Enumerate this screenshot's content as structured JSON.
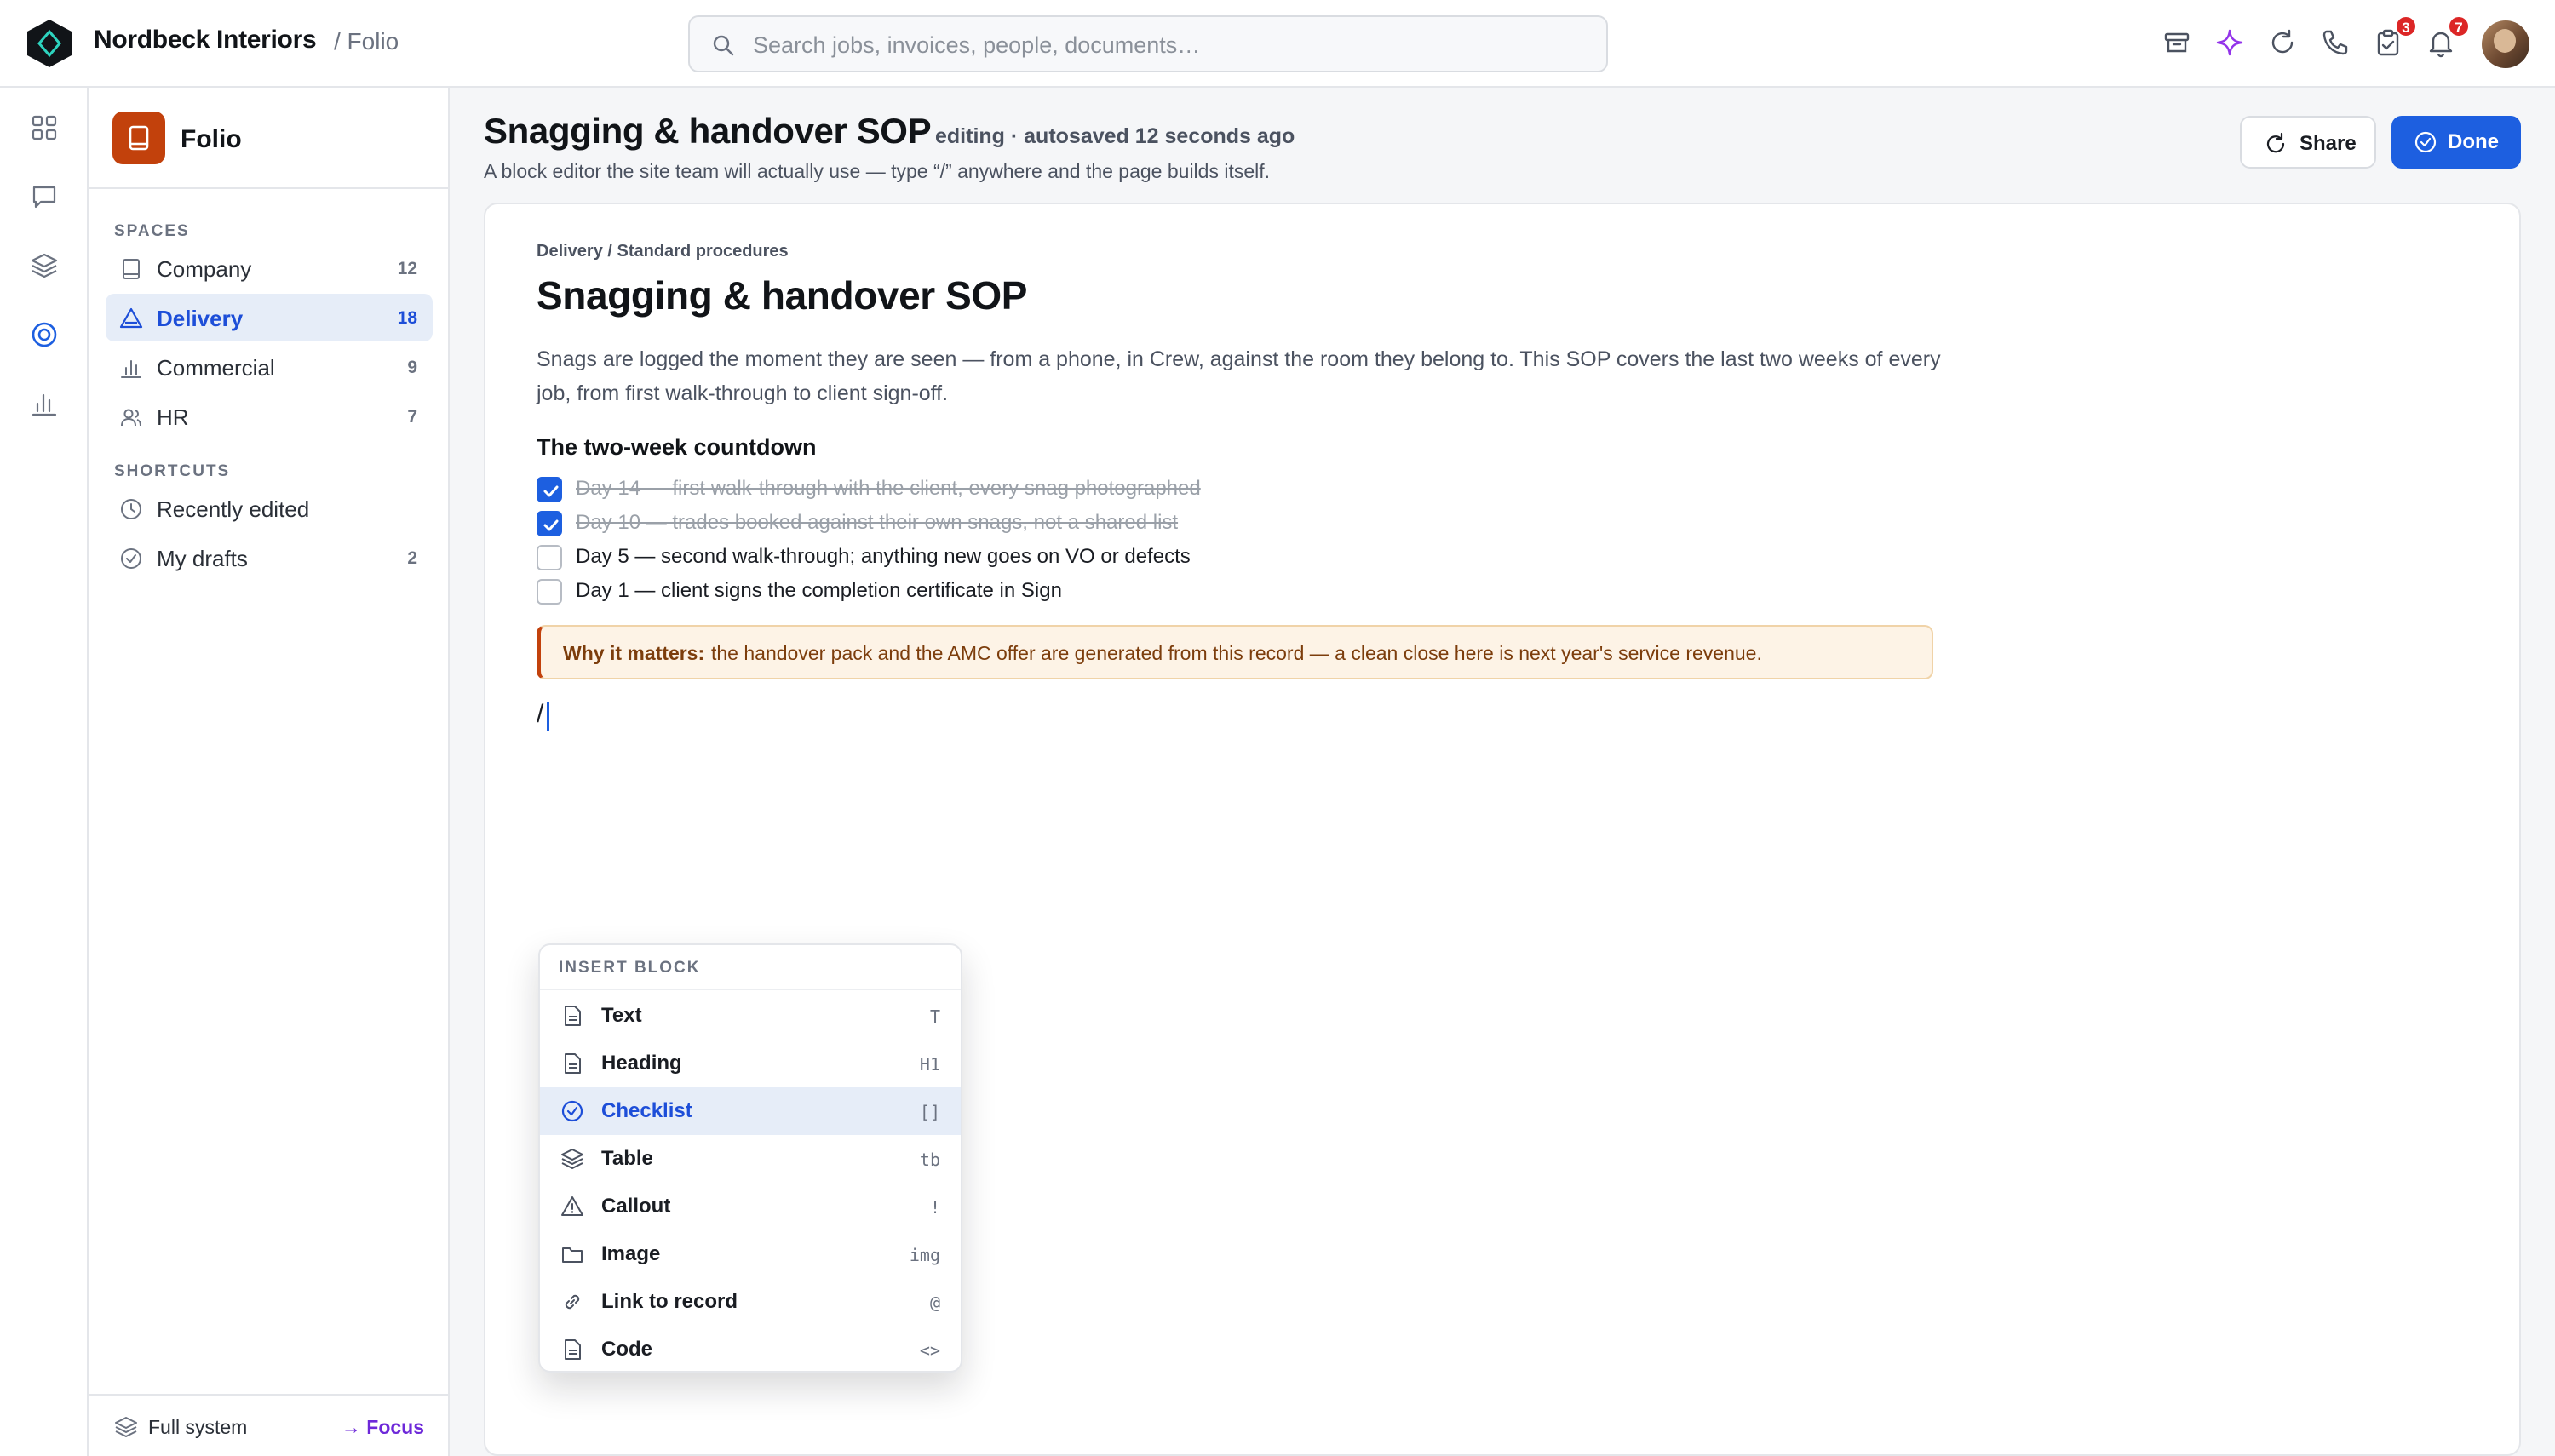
{
  "app": {
    "brand": "Nordbeck Interiors",
    "app_crumb": "/ Folio",
    "search_placeholder": "Search jobs, invoices, people, documents…",
    "accent": "#1d5fe0",
    "brand_orange": "#c2410c"
  },
  "topbar_icons": [
    {
      "icon": "archive-icon"
    },
    {
      "icon": "sparkle-icon"
    },
    {
      "icon": "refresh-icon"
    },
    {
      "icon": "phone-icon"
    },
    {
      "icon": "clipboard-check-icon",
      "badge": "3"
    },
    {
      "icon": "bell-icon",
      "badge": "7"
    }
  ],
  "rail": [
    {
      "icon": "grid-icon"
    },
    {
      "icon": "chat-icon"
    },
    {
      "icon": "layers-icon"
    },
    {
      "icon": "target-icon",
      "active": true
    },
    {
      "icon": "bar-chart-icon"
    }
  ],
  "sidebar": {
    "app_name": "Folio",
    "spaces_heading": "SPACES",
    "spaces": [
      {
        "label": "Company",
        "count": "12",
        "icon": "book-icon"
      },
      {
        "label": "Delivery",
        "count": "18",
        "icon": "warning-triangle-icon",
        "active": true
      },
      {
        "label": "Commercial",
        "count": "9",
        "icon": "bar-chart-icon"
      },
      {
        "label": "HR",
        "count": "7",
        "icon": "people-icon"
      }
    ],
    "shortcuts_heading": "SHORTCUTS",
    "shortcuts": [
      {
        "label": "Recently edited",
        "count": "",
        "icon": "clock-icon"
      },
      {
        "label": "My drafts",
        "count": "2",
        "icon": "check-circle-icon"
      }
    ],
    "footer": {
      "label": "Full system",
      "focus": "→ Focus"
    }
  },
  "header": {
    "title": "Snagging & handover SOP",
    "status": "editing · autosaved 12 seconds ago",
    "subtitle": "A block editor the site team will actually use — type “/” anywhere and the page builds itself.",
    "share_label": "Share",
    "done_label": "Done"
  },
  "doc": {
    "breadcrumb": "Delivery / Standard procedures",
    "title": "Snagging & handover SOP",
    "paragraph": "Snags are logged the moment they are seen — from a phone, in Crew, against the room they belong to. This SOP covers the last two weeks of every job, from first walk-through to client sign-off.",
    "heading": "The two-week countdown",
    "checklist": [
      {
        "text": "Day 14 — first walk-through with the client, every snag photographed",
        "checked": true
      },
      {
        "text": "Day 10 — trades booked against their own snags, not a shared list",
        "checked": true
      },
      {
        "text": "Day 5 — second walk-through; anything new goes on VO or defects",
        "checked": false
      },
      {
        "text": "Day 1 — client signs the completion certificate in Sign",
        "checked": false
      }
    ],
    "callout_bold": "Why it matters:",
    "callout_text": "the handover pack and the AMC offer are generated from this record — a clean close here is next year's service revenue.",
    "slash_input": "/"
  },
  "insert_menu": {
    "heading": "INSERT BLOCK",
    "items": [
      {
        "label": "Text",
        "key": "T",
        "icon": "document-icon"
      },
      {
        "label": "Heading",
        "key": "H1",
        "icon": "document-icon"
      },
      {
        "label": "Checklist",
        "key": "[]",
        "icon": "check-circle-icon",
        "active": true
      },
      {
        "label": "Table",
        "key": "tb",
        "icon": "layers-icon"
      },
      {
        "label": "Callout",
        "key": "!",
        "icon": "warning-triangle-icon"
      },
      {
        "label": "Image",
        "key": "img",
        "icon": "folder-icon"
      },
      {
        "label": "Link to record",
        "key": "@",
        "icon": "link-icon"
      },
      {
        "label": "Code",
        "key": "<>",
        "icon": "document-icon"
      }
    ]
  }
}
